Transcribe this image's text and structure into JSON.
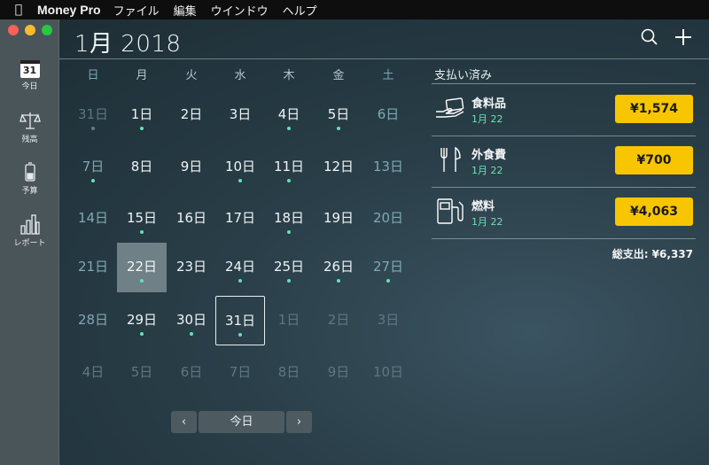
{
  "menubar": {
    "app_name": "Money Pro",
    "menus": [
      "ファイル",
      "編集",
      "ウインドウ",
      "ヘルプ"
    ]
  },
  "sidebar": {
    "items": [
      {
        "label": "今日",
        "icon": "calendar-icon",
        "icon_text": "31"
      },
      {
        "label": "残高",
        "icon": "balance-scale-icon"
      },
      {
        "label": "予算",
        "icon": "battery-icon"
      },
      {
        "label": "レポート",
        "icon": "bar-chart-icon"
      }
    ]
  },
  "header": {
    "title": "1月 2018",
    "search_icon": "search-icon",
    "add_icon": "plus-icon"
  },
  "calendar": {
    "weekdays": [
      "日",
      "月",
      "火",
      "水",
      "木",
      "金",
      "土"
    ],
    "weeks": [
      [
        {
          "d": "31日",
          "o": true,
          "dot": "dim"
        },
        {
          "d": "1日",
          "dot": "on"
        },
        {
          "d": "2日"
        },
        {
          "d": "3日"
        },
        {
          "d": "4日",
          "dot": "on"
        },
        {
          "d": "5日",
          "dot": "on"
        },
        {
          "d": "6日"
        }
      ],
      [
        {
          "d": "7日",
          "dot": "on"
        },
        {
          "d": "8日"
        },
        {
          "d": "9日"
        },
        {
          "d": "10日",
          "dot": "on"
        },
        {
          "d": "11日",
          "dot": "on"
        },
        {
          "d": "12日"
        },
        {
          "d": "13日"
        }
      ],
      [
        {
          "d": "14日"
        },
        {
          "d": "15日",
          "dot": "on"
        },
        {
          "d": "16日"
        },
        {
          "d": "17日"
        },
        {
          "d": "18日",
          "dot": "on"
        },
        {
          "d": "19日"
        },
        {
          "d": "20日"
        }
      ],
      [
        {
          "d": "21日"
        },
        {
          "d": "22日",
          "dot": "on",
          "sel": true
        },
        {
          "d": "23日"
        },
        {
          "d": "24日",
          "dot": "on"
        },
        {
          "d": "25日",
          "dot": "on"
        },
        {
          "d": "26日",
          "dot": "on"
        },
        {
          "d": "27日",
          "dot": "on"
        }
      ],
      [
        {
          "d": "28日"
        },
        {
          "d": "29日",
          "dot": "on"
        },
        {
          "d": "30日",
          "dot": "on"
        },
        {
          "d": "31日",
          "dot": "on",
          "today": true
        },
        {
          "d": "1日",
          "o": true
        },
        {
          "d": "2日",
          "o": true
        },
        {
          "d": "3日",
          "o": true
        }
      ],
      [
        {
          "d": "4日",
          "o": true
        },
        {
          "d": "5日",
          "o": true
        },
        {
          "d": "6日",
          "o": true
        },
        {
          "d": "7日",
          "o": true
        },
        {
          "d": "8日",
          "o": true
        },
        {
          "d": "9日",
          "o": true
        },
        {
          "d": "10日",
          "o": true
        }
      ]
    ],
    "nav": {
      "prev": "‹",
      "today": "今日",
      "next": "›"
    }
  },
  "panel": {
    "title": "支払い済み",
    "transactions": [
      {
        "category": "食料品",
        "date": "1月 22",
        "amount": "¥1,574",
        "icon": "hand-card-icon"
      },
      {
        "category": "外食費",
        "date": "1月 22",
        "amount": "¥700",
        "icon": "fork-knife-icon"
      },
      {
        "category": "燃料",
        "date": "1月 22",
        "amount": "¥4,063",
        "icon": "fuel-pump-icon"
      }
    ],
    "total": "総支出: ¥6,337"
  },
  "colors": {
    "accent_yellow": "#f7c600",
    "dot_green": "#63e2b3",
    "date_green": "#6fe0b4"
  }
}
